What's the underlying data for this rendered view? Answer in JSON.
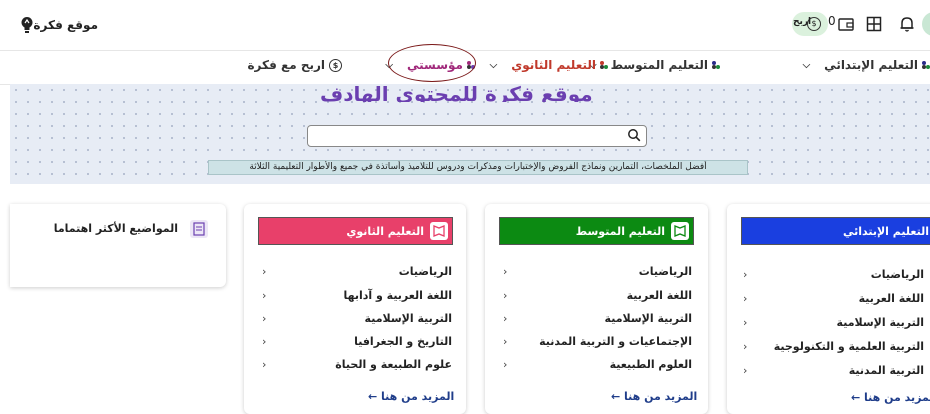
{
  "header": {
    "site_name": "موقع فكرة",
    "earn_label": "اربح",
    "coin_symbol": "$",
    "balance": "0"
  },
  "nav": {
    "items": [
      {
        "label": "التعليم الإبتدائي"
      },
      {
        "label": "التعليم المتوسط"
      },
      {
        "label": "التعليم الثانوي"
      },
      {
        "label": "مؤسستي"
      },
      {
        "label": "اربح مع فكرة"
      }
    ]
  },
  "hero": {
    "title": "موقع فكرة للمحتوى الهادف",
    "search_placeholder": "",
    "tagline": "أفضل الملخصات، التمارين ونماذج الفروض والإختبارات ومذكرات ودروس للتلاميذ وأساتذة في جميع والأطوار التعليمية الثلاثة"
  },
  "cards": [
    {
      "title": "التعليم الإبتدائي",
      "color": "#1a3fe0",
      "subjects": [
        "الرياضيات",
        "اللغة العربية",
        "التربية الإسلامية",
        "التربية العلمية و التكنولوجية",
        "التربية المدنية"
      ],
      "more": "المزيد من هنا"
    },
    {
      "title": "التعليم المتوسط",
      "color": "#0c8a12",
      "subjects": [
        "الرياضيات",
        "اللغة العربية",
        "التربية الإسلامية",
        "الإجتماعيات و التربية المدنية",
        "العلوم الطبيعية"
      ],
      "more": "المزيد من هنا"
    },
    {
      "title": "التعليم الثانوي",
      "color": "#e8406a",
      "subjects": [
        "الرياضيات",
        "اللغة العربية و آدابها",
        "التربية الإسلامية",
        "التاريخ و الجغرافيا",
        "علوم الطبيعة و الحياة"
      ],
      "more": "المزيد من هنا"
    }
  ],
  "topics": {
    "title": "المواضيع الأكثر اهتماما"
  },
  "colors": {
    "accent": "#6b3fb0",
    "nav_highlight": "#a0287a",
    "link": "#1f3d8a"
  }
}
